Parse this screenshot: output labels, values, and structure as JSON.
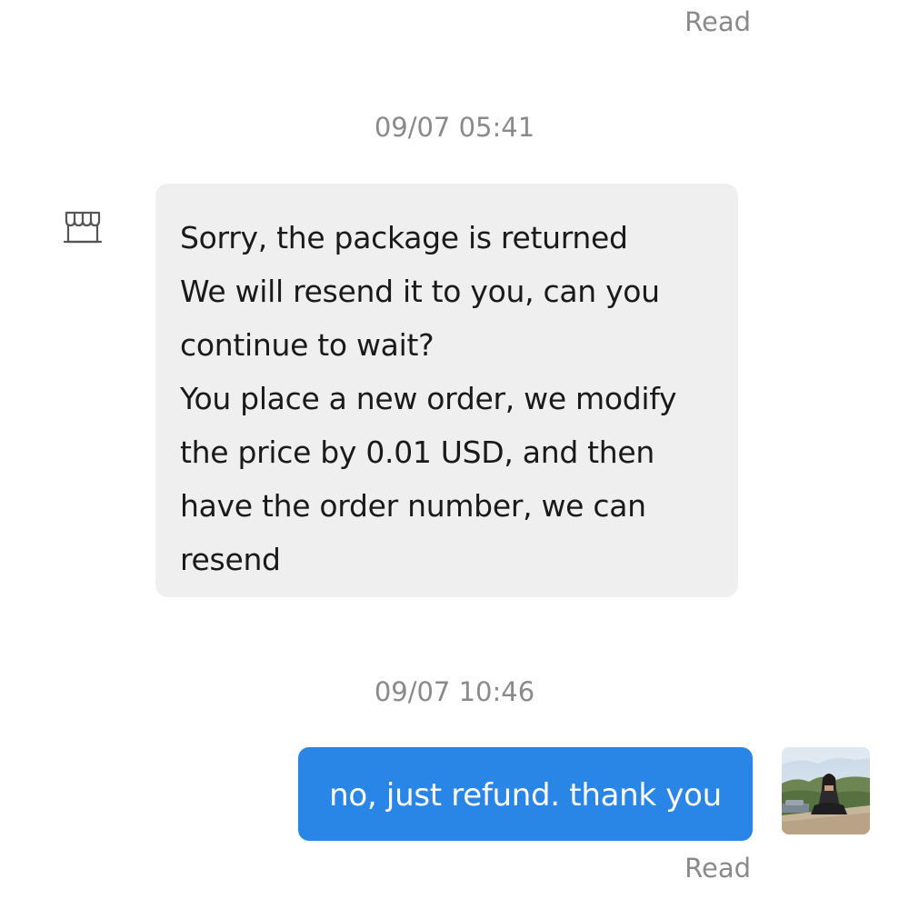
{
  "chat": {
    "top_status": "Read",
    "timestamp_1": "09/07 05:41",
    "incoming_message": {
      "lines": [
        "Sorry, the package is returned",
        "We will resend it to you, can you",
        "continue to wait?",
        "You place a new order, we modify",
        "the price by 0.01 USD, and then",
        "have the order number, we can",
        "resend"
      ],
      "bubble_color": "#efefef"
    },
    "timestamp_2": "09/07 10:46",
    "outgoing_message": {
      "text": "no, just refund. thank you",
      "bubble_color": "#2a86e6"
    },
    "bottom_status": "Read"
  },
  "icons": {
    "seller_avatar": "store-icon",
    "user_avatar": "user-avatar-photo"
  }
}
